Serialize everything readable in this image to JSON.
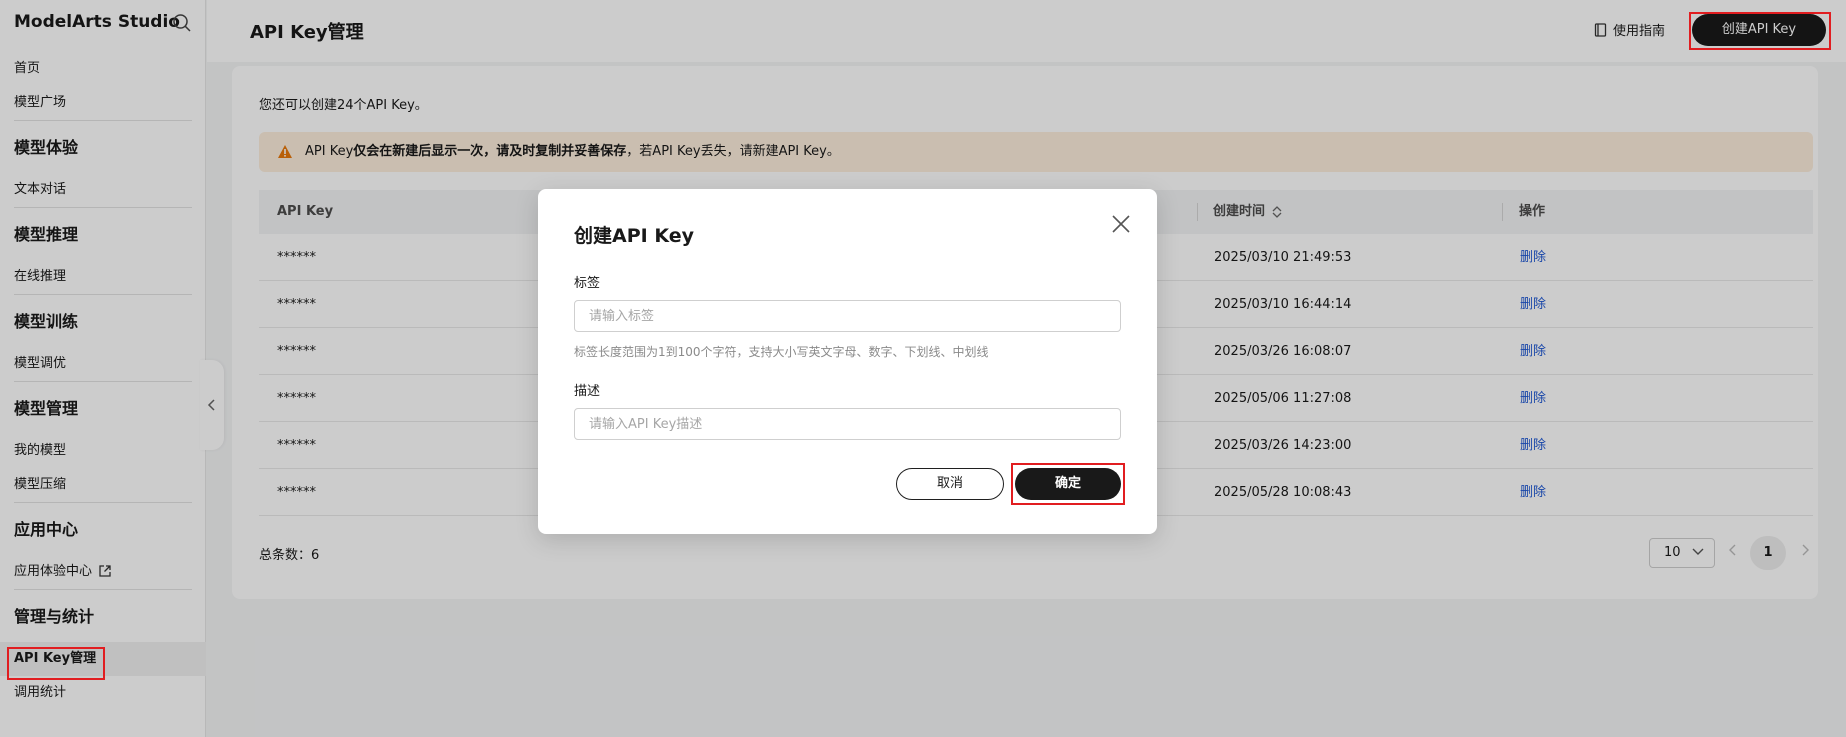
{
  "sidebar": {
    "brand": "ModelArts Studio",
    "items": [
      {
        "type": "item",
        "label": "首页"
      },
      {
        "type": "item",
        "label": "模型广场"
      },
      {
        "type": "sep"
      },
      {
        "type": "group",
        "label": "模型体验"
      },
      {
        "type": "item",
        "label": "文本对话"
      },
      {
        "type": "sep"
      },
      {
        "type": "group",
        "label": "模型推理"
      },
      {
        "type": "item",
        "label": "在线推理"
      },
      {
        "type": "sep"
      },
      {
        "type": "group",
        "label": "模型训练"
      },
      {
        "type": "item",
        "label": "模型调优"
      },
      {
        "type": "sep"
      },
      {
        "type": "group",
        "label": "模型管理"
      },
      {
        "type": "item",
        "label": "我的模型"
      },
      {
        "type": "item",
        "label": "模型压缩"
      },
      {
        "type": "sep"
      },
      {
        "type": "group",
        "label": "应用中心"
      },
      {
        "type": "item",
        "label": "应用体验中心",
        "external": true
      },
      {
        "type": "sep"
      },
      {
        "type": "group",
        "label": "管理与统计"
      },
      {
        "type": "item",
        "label": "API Key管理",
        "active": true
      },
      {
        "type": "item",
        "label": "调用统计"
      }
    ]
  },
  "header": {
    "title": "API Key管理",
    "guide_label": "使用指南",
    "create_label": "创建API Key"
  },
  "main": {
    "quota_text": "您还可以创建24个API Key。",
    "warning": {
      "prefix": "API Key",
      "bold": "仅会在新建后显示一次，请及时复制并妥善保存",
      "suffix": "，若API Key丢失，请新建API Key。"
    },
    "table": {
      "columns": {
        "key": "API Key",
        "created": "创建时间",
        "ops": "操作"
      },
      "rows": [
        {
          "key": "******",
          "created": "2025/03/10 21:49:53",
          "action": "删除"
        },
        {
          "key": "******",
          "created": "2025/03/10 16:44:14",
          "action": "删除"
        },
        {
          "key": "******",
          "created": "2025/03/26 16:08:07",
          "action": "删除"
        },
        {
          "key": "******",
          "created": "2025/05/06 11:27:08",
          "action": "删除"
        },
        {
          "key": "******",
          "created": "2025/03/26 14:23:00",
          "action": "删除"
        },
        {
          "key": "******",
          "created": "2025/05/28 10:08:43",
          "action": "删除"
        }
      ]
    },
    "total_label": "总条数：6",
    "page_size": "10",
    "current_page": "1"
  },
  "dialog": {
    "title": "创建API Key",
    "tag_label": "标签",
    "tag_placeholder": "请输入标签",
    "tag_hint": "标签长度范围为1到100个字符，支持大小写英文字母、数字、下划线、中划线",
    "desc_label": "描述",
    "desc_placeholder": "请输入API Key描述",
    "cancel_label": "取消",
    "ok_label": "确定"
  },
  "colors": {
    "primary": "#191919",
    "link": "#1f58d4",
    "highlight": "#e11d20",
    "warning_bg": "#fdeedc",
    "warning_icon": "#e8780c"
  }
}
